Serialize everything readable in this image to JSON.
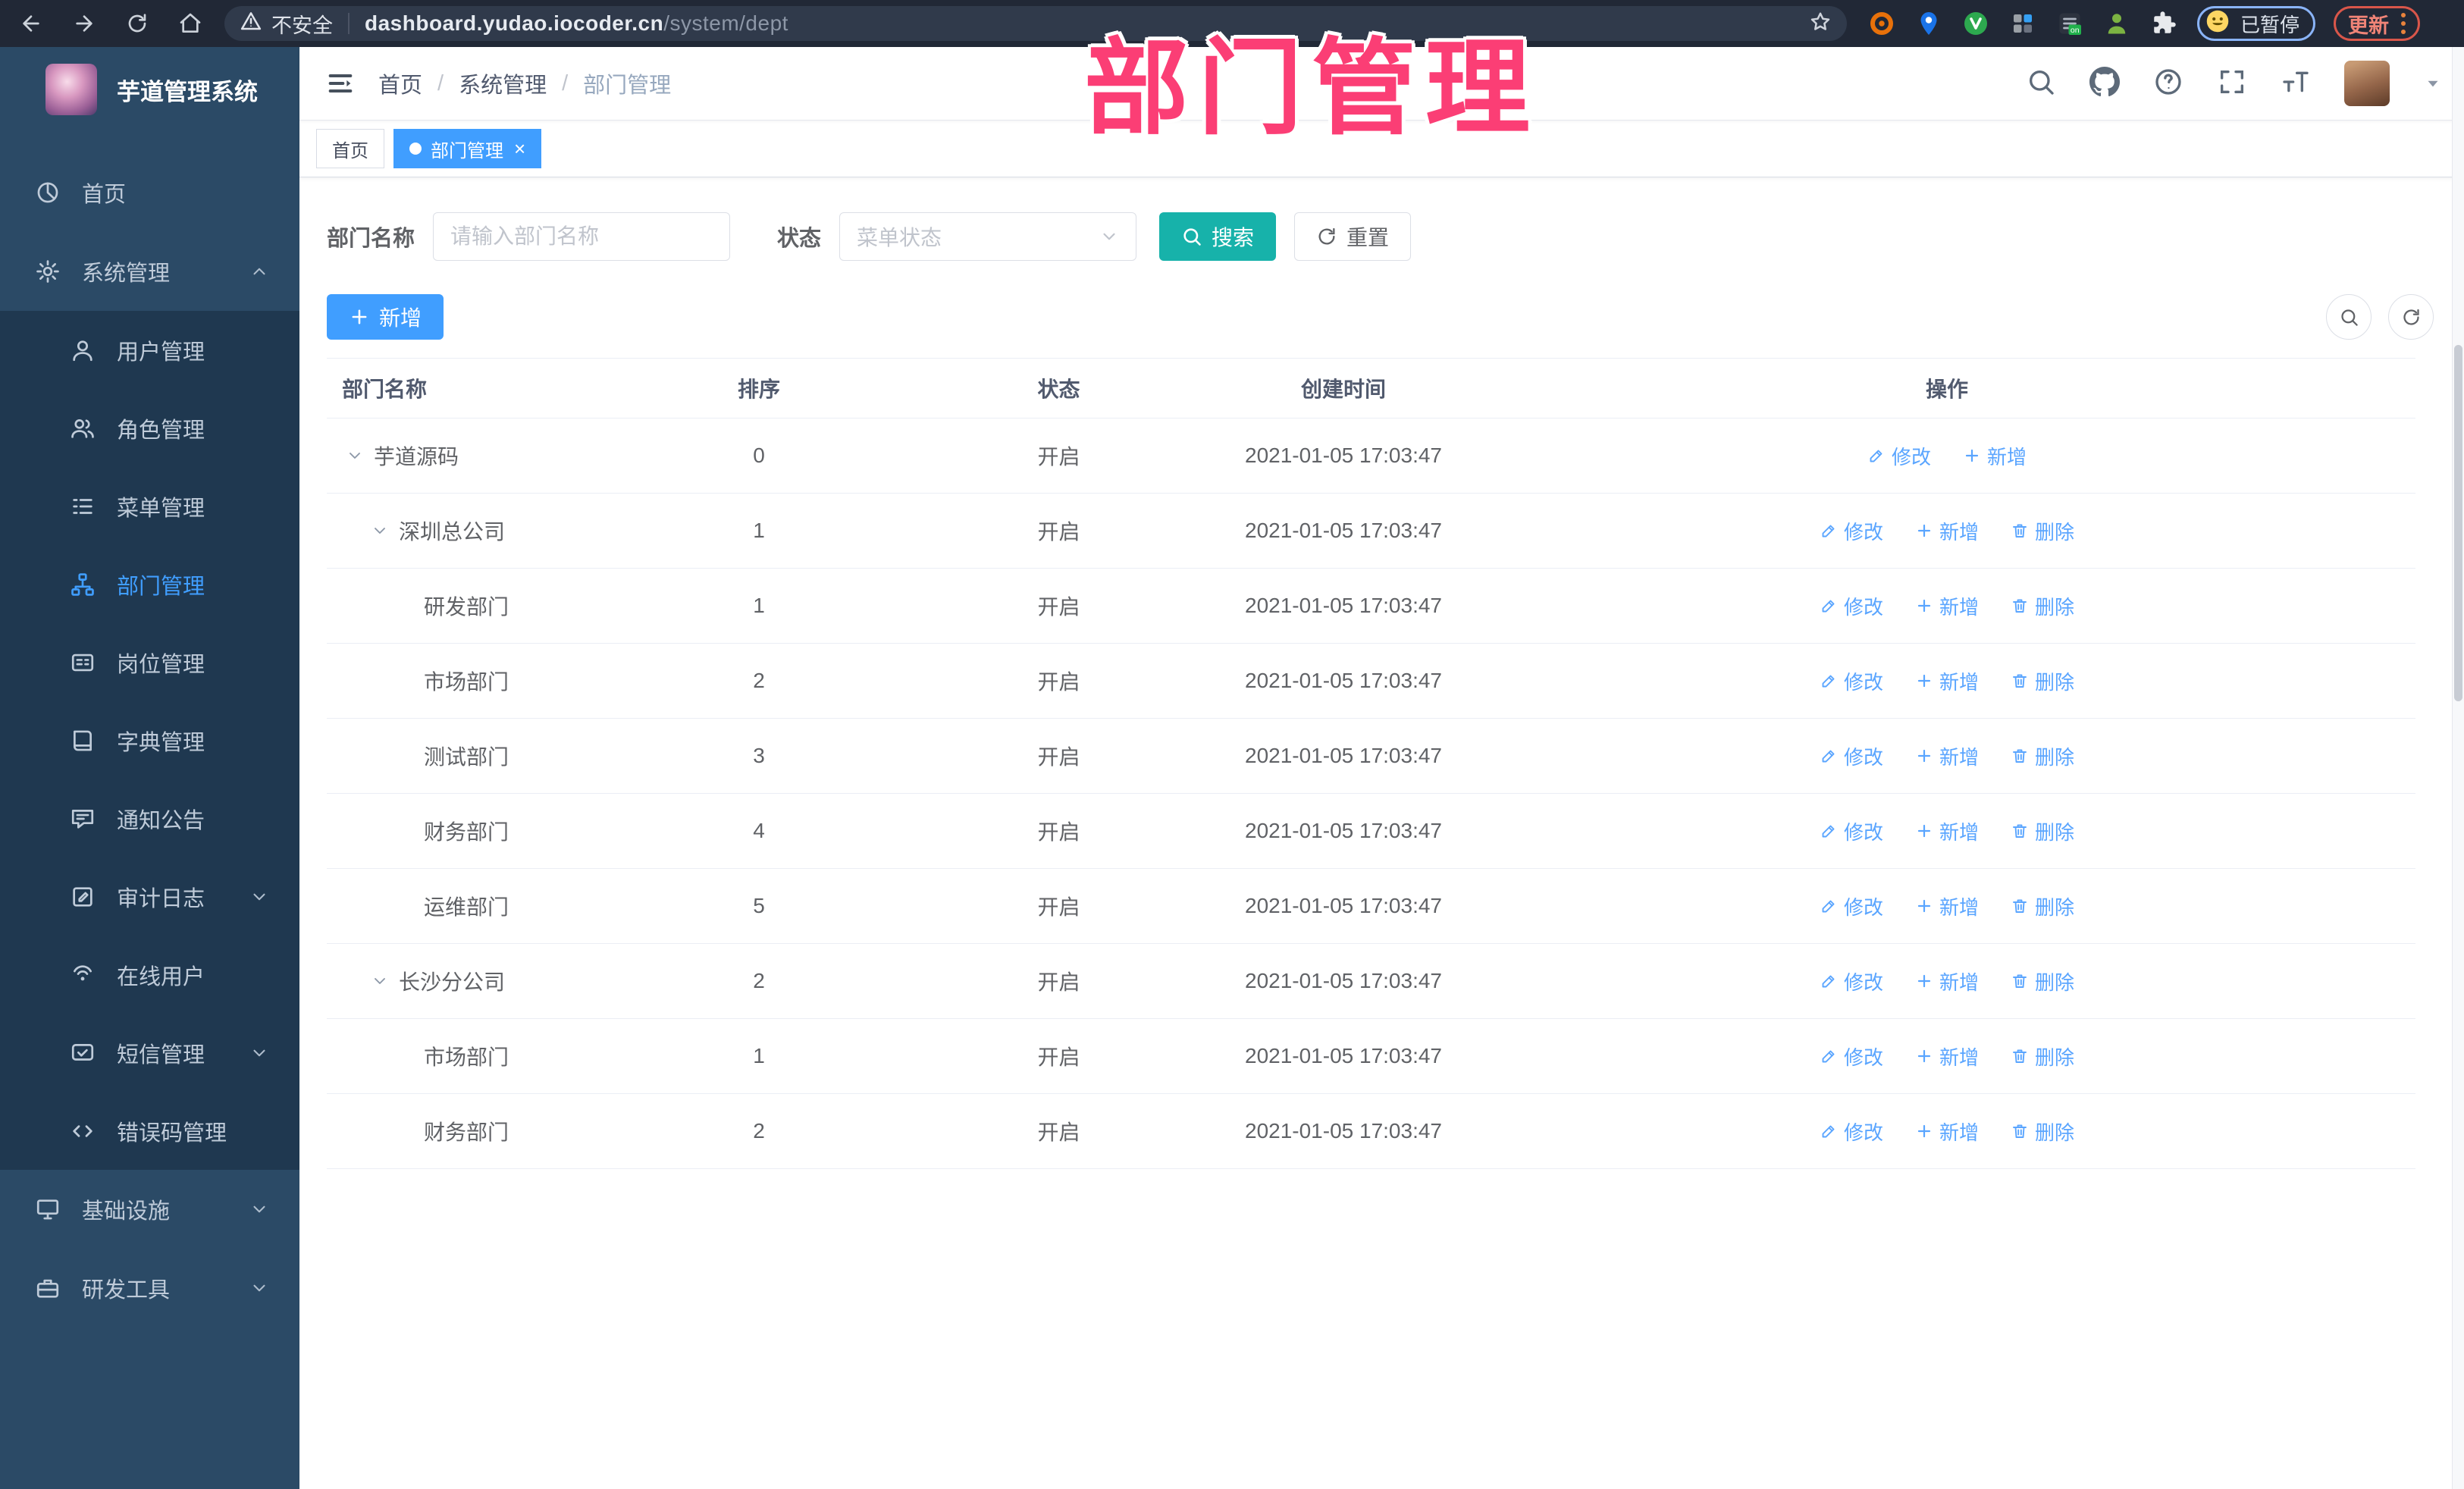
{
  "colors": {
    "accent": "#409eff",
    "teal": "#17b2aa",
    "pink": "#fb3e75",
    "link": "#5aa5ff",
    "chrome_bg": "#212836",
    "chrome_pill": "#303a4b",
    "sidebar_bg": "#2b4a66",
    "sidebar_submenu_bg": "#1f3850",
    "sidebar_text": "#bfcbd9",
    "text_primary": "#515a6e",
    "text_regular": "#606266",
    "border": "#dcdfe6",
    "divider": "#ebeef5",
    "breadcrumb_last": "#97a8be"
  },
  "browser": {
    "security_label": "不安全",
    "url_host": "dashboard.yudao.iocoder.cn",
    "url_path": "/system/dept",
    "profile_status": "已暂停",
    "update_label": "更新"
  },
  "overlay": {
    "title": "部门管理"
  },
  "sidebar": {
    "logo_title": "芋道管理系统",
    "items": [
      {
        "label": "首页",
        "icon": "dashboard-icon",
        "level": "top"
      },
      {
        "label": "系统管理",
        "icon": "gear-icon",
        "level": "top",
        "chevron": "up",
        "expanded": true
      },
      {
        "label": "用户管理",
        "icon": "user-icon",
        "level": "sub"
      },
      {
        "label": "角色管理",
        "icon": "users-icon",
        "level": "sub"
      },
      {
        "label": "菜单管理",
        "icon": "menu-list-icon",
        "level": "sub"
      },
      {
        "label": "部门管理",
        "icon": "org-tree-icon",
        "level": "sub",
        "active": true
      },
      {
        "label": "岗位管理",
        "icon": "id-badge-icon",
        "level": "sub"
      },
      {
        "label": "字典管理",
        "icon": "dictionary-icon",
        "level": "sub"
      },
      {
        "label": "通知公告",
        "icon": "announcement-icon",
        "level": "sub"
      },
      {
        "label": "审计日志",
        "icon": "audit-log-icon",
        "level": "sub",
        "chevron": "down"
      },
      {
        "label": "在线用户",
        "icon": "online-users-icon",
        "level": "sub"
      },
      {
        "label": "短信管理",
        "icon": "sms-icon",
        "level": "sub",
        "chevron": "down"
      },
      {
        "label": "错误码管理",
        "icon": "code-icon",
        "level": "sub"
      },
      {
        "label": "基础设施",
        "icon": "infrastructure-icon",
        "level": "top",
        "chevron": "down"
      },
      {
        "label": "研发工具",
        "icon": "devtools-icon",
        "level": "top",
        "chevron": "down"
      }
    ]
  },
  "header": {
    "breadcrumb": [
      "首页",
      "系统管理",
      "部门管理"
    ]
  },
  "tabs": [
    {
      "label": "首页",
      "active": false
    },
    {
      "label": "部门管理",
      "active": true,
      "closable": true
    }
  ],
  "filters": {
    "name_label": "部门名称",
    "name_placeholder": "请输入部门名称",
    "status_label": "状态",
    "status_placeholder": "菜单状态",
    "search_label": "搜索",
    "reset_label": "重置"
  },
  "toolbar": {
    "add_label": "新增"
  },
  "table": {
    "columns": [
      "部门名称",
      "排序",
      "状态",
      "创建时间",
      "操作"
    ],
    "rows": [
      {
        "name": "芋道源码",
        "level": 0,
        "expandable": true,
        "sort": "0",
        "status": "开启",
        "created": "2021-01-05 17:03:47",
        "actions": [
          {
            "type": "edit",
            "label": "修改"
          },
          {
            "type": "add",
            "label": "新增"
          }
        ]
      },
      {
        "name": "深圳总公司",
        "level": 1,
        "expandable": true,
        "sort": "1",
        "status": "开启",
        "created": "2021-01-05 17:03:47",
        "actions": [
          {
            "type": "edit",
            "label": "修改"
          },
          {
            "type": "add",
            "label": "新增"
          },
          {
            "type": "delete",
            "label": "删除"
          }
        ]
      },
      {
        "name": "研发部门",
        "level": 2,
        "expandable": false,
        "sort": "1",
        "status": "开启",
        "created": "2021-01-05 17:03:47",
        "actions": [
          {
            "type": "edit",
            "label": "修改"
          },
          {
            "type": "add",
            "label": "新增"
          },
          {
            "type": "delete",
            "label": "删除"
          }
        ]
      },
      {
        "name": "市场部门",
        "level": 2,
        "expandable": false,
        "sort": "2",
        "status": "开启",
        "created": "2021-01-05 17:03:47",
        "actions": [
          {
            "type": "edit",
            "label": "修改"
          },
          {
            "type": "add",
            "label": "新增"
          },
          {
            "type": "delete",
            "label": "删除"
          }
        ]
      },
      {
        "name": "测试部门",
        "level": 2,
        "expandable": false,
        "sort": "3",
        "status": "开启",
        "created": "2021-01-05 17:03:47",
        "actions": [
          {
            "type": "edit",
            "label": "修改"
          },
          {
            "type": "add",
            "label": "新增"
          },
          {
            "type": "delete",
            "label": "删除"
          }
        ]
      },
      {
        "name": "财务部门",
        "level": 2,
        "expandable": false,
        "sort": "4",
        "status": "开启",
        "created": "2021-01-05 17:03:47",
        "actions": [
          {
            "type": "edit",
            "label": "修改"
          },
          {
            "type": "add",
            "label": "新增"
          },
          {
            "type": "delete",
            "label": "删除"
          }
        ]
      },
      {
        "name": "运维部门",
        "level": 2,
        "expandable": false,
        "sort": "5",
        "status": "开启",
        "created": "2021-01-05 17:03:47",
        "actions": [
          {
            "type": "edit",
            "label": "修改"
          },
          {
            "type": "add",
            "label": "新增"
          },
          {
            "type": "delete",
            "label": "删除"
          }
        ]
      },
      {
        "name": "长沙分公司",
        "level": 1,
        "expandable": true,
        "sort": "2",
        "status": "开启",
        "created": "2021-01-05 17:03:47",
        "actions": [
          {
            "type": "edit",
            "label": "修改"
          },
          {
            "type": "add",
            "label": "新增"
          },
          {
            "type": "delete",
            "label": "删除"
          }
        ]
      },
      {
        "name": "市场部门",
        "level": 2,
        "expandable": false,
        "sort": "1",
        "status": "开启",
        "created": "2021-01-05 17:03:47",
        "actions": [
          {
            "type": "edit",
            "label": "修改"
          },
          {
            "type": "add",
            "label": "新增"
          },
          {
            "type": "delete",
            "label": "删除"
          }
        ]
      },
      {
        "name": "财务部门",
        "level": 2,
        "expandable": false,
        "sort": "2",
        "status": "开启",
        "created": "2021-01-05 17:03:47",
        "actions": [
          {
            "type": "edit",
            "label": "修改"
          },
          {
            "type": "add",
            "label": "新增"
          },
          {
            "type": "delete",
            "label": "删除"
          }
        ]
      }
    ]
  }
}
